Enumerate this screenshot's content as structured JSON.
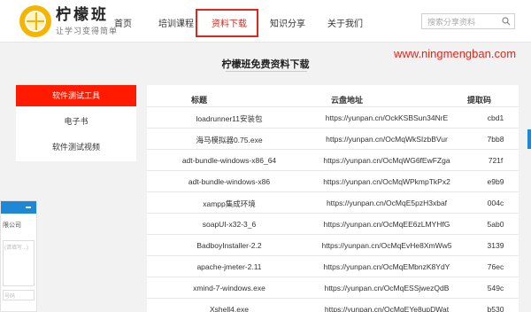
{
  "header": {
    "brand_name": "柠檬班",
    "brand_tag": "让学习变得简单",
    "nav": [
      {
        "label": "首页"
      },
      {
        "label": "培训课程"
      },
      {
        "label": "资料下载"
      },
      {
        "label": "知识分享"
      },
      {
        "label": "关于我们"
      }
    ],
    "active_nav": "资料下载",
    "search_placeholder": "搜索分享资料"
  },
  "banner": {
    "title": "柠檬班免费资料下载",
    "watermark": "www.ningmengban.com"
  },
  "sidebar": {
    "items": [
      {
        "label": "软件测试工具",
        "active": true
      },
      {
        "label": "电子书",
        "active": false
      },
      {
        "label": "软件测试视频",
        "active": false
      }
    ]
  },
  "table": {
    "headers": [
      "标题",
      "云盘地址",
      "提取码"
    ],
    "rows": [
      {
        "title": "loadrunner11安装包",
        "url": "https://yunpan.cn/OckKSBSun34NrE",
        "code": "cbd1"
      },
      {
        "title": "海马模拟器0.75.exe",
        "url": "https://yunpan.cn/OcMqWkSIzbBVur",
        "code": "7bb8"
      },
      {
        "title": "adt-bundle-windows-x86_64",
        "url": "https://yunpan.cn/OcMqWG6fEwFZga",
        "code": "721f"
      },
      {
        "title": "adt-bundle-windows-x86",
        "url": "https://yunpan.cn/OcMqWPkmpTkPx2",
        "code": "e9b9"
      },
      {
        "title": "xampp集成环境",
        "url": "https://yunpan.cn/OcMqE5pzH3xbaf",
        "code": "004c"
      },
      {
        "title": "soapUI-x32-3_6",
        "url": "https://yunpan.cn/OcMqEE6zLMYHfG",
        "code": "5ab0"
      },
      {
        "title": "BadboyInstaller-2.2",
        "url": "https://yunpan.cn/OcMqEvHe8XmWw5",
        "code": "3139"
      },
      {
        "title": "apache-jmeter-2.11",
        "url": "https://yunpan.cn/OcMqEMbnzK8YdY",
        "code": "76ec"
      },
      {
        "title": "xmind-7-windows.exe",
        "url": "https://yunpan.cn/OcMqESSjwezQdB",
        "code": "549c"
      },
      {
        "title": "Xshell4.exe",
        "url": "https://yunpan.cn/OcMqEYe8upDWat",
        "code": "b530"
      }
    ]
  },
  "float_widget": {
    "text": "限公司",
    "box1_placeholder": "(请填写...)",
    "box2_placeholder": "号码"
  },
  "colors": {
    "accent_red": "#e0261b",
    "sidebar_active": "#ff1a00",
    "brand_yellow": "#f5b400",
    "widget_blue": "#1e88d6"
  }
}
